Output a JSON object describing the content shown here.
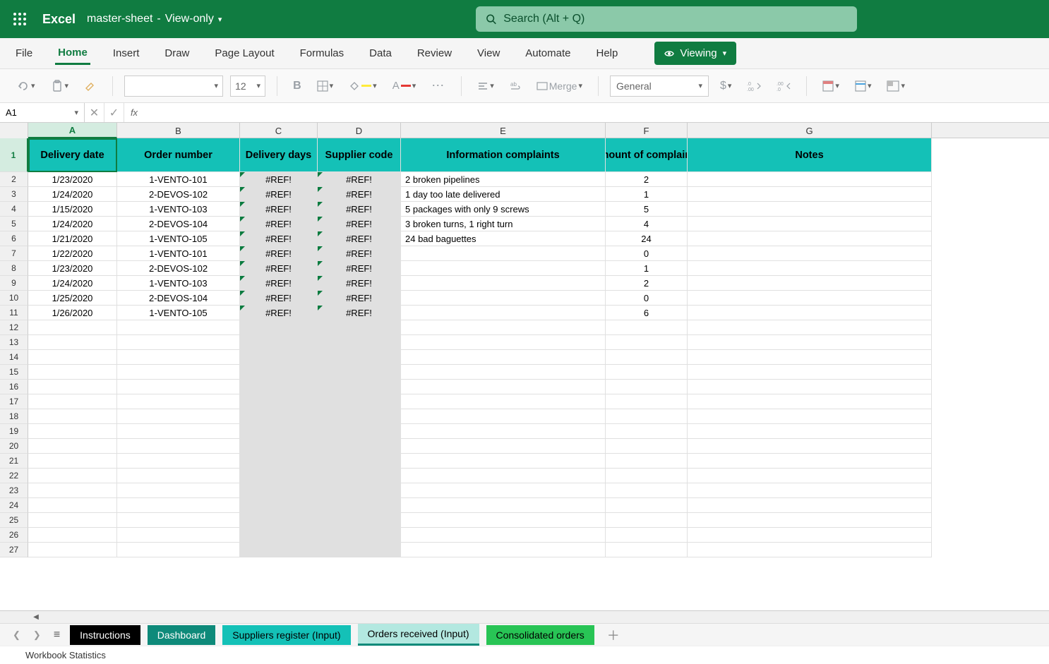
{
  "app": {
    "name": "Excel"
  },
  "doc": {
    "name": "master-sheet",
    "mode": "View-only"
  },
  "search": {
    "placeholder": "Search (Alt + Q)"
  },
  "ribbon": {
    "tabs": [
      "File",
      "Home",
      "Insert",
      "Draw",
      "Page Layout",
      "Formulas",
      "Data",
      "Review",
      "View",
      "Automate",
      "Help"
    ],
    "active": "Home",
    "viewing_label": "Viewing"
  },
  "toolbar": {
    "font_size": "12",
    "merge_label": "Merge",
    "number_format": "General"
  },
  "namebox": {
    "value": "A1"
  },
  "formula": {
    "value": ""
  },
  "columns": [
    "A",
    "B",
    "C",
    "D",
    "E",
    "F",
    "G"
  ],
  "headers": {
    "A": "Delivery date",
    "B": "Order number",
    "C": "Delivery days",
    "D": "Supplier code",
    "E": "Information complaints",
    "F": "Amount of complaints",
    "G": "Notes"
  },
  "rows": [
    {
      "n": 2,
      "A": "1/23/2020",
      "B": "1-VENTO-101",
      "C": "#REF!",
      "D": "#REF!",
      "E": "2 broken pipelines",
      "F": "2",
      "G": ""
    },
    {
      "n": 3,
      "A": "1/24/2020",
      "B": "2-DEVOS-102",
      "C": "#REF!",
      "D": "#REF!",
      "E": "1 day too late delivered",
      "F": "1",
      "G": ""
    },
    {
      "n": 4,
      "A": "1/15/2020",
      "B": "1-VENTO-103",
      "C": "#REF!",
      "D": "#REF!",
      "E": "5 packages with only 9 screws",
      "F": "5",
      "G": ""
    },
    {
      "n": 5,
      "A": "1/24/2020",
      "B": "2-DEVOS-104",
      "C": "#REF!",
      "D": "#REF!",
      "E": "3 broken turns, 1 right turn",
      "F": "4",
      "G": ""
    },
    {
      "n": 6,
      "A": "1/21/2020",
      "B": "1-VENTO-105",
      "C": "#REF!",
      "D": "#REF!",
      "E": "24 bad baguettes",
      "F": "24",
      "G": ""
    },
    {
      "n": 7,
      "A": "1/22/2020",
      "B": "1-VENTO-101",
      "C": "#REF!",
      "D": "#REF!",
      "E": "",
      "F": "0",
      "G": ""
    },
    {
      "n": 8,
      "A": "1/23/2020",
      "B": "2-DEVOS-102",
      "C": "#REF!",
      "D": "#REF!",
      "E": "",
      "F": "1",
      "G": ""
    },
    {
      "n": 9,
      "A": "1/24/2020",
      "B": "1-VENTO-103",
      "C": "#REF!",
      "D": "#REF!",
      "E": "",
      "F": "2",
      "G": ""
    },
    {
      "n": 10,
      "A": "1/25/2020",
      "B": "2-DEVOS-104",
      "C": "#REF!",
      "D": "#REF!",
      "E": "",
      "F": "0",
      "G": ""
    },
    {
      "n": 11,
      "A": "1/26/2020",
      "B": "1-VENTO-105",
      "C": "#REF!",
      "D": "#REF!",
      "E": "",
      "F": "6",
      "G": ""
    }
  ],
  "empty_rows": [
    12,
    13,
    14,
    15,
    16,
    17,
    18,
    19,
    20,
    21,
    22,
    23,
    24,
    25,
    26,
    27
  ],
  "sheets": {
    "tabs": [
      "Instructions",
      "Dashboard",
      "Suppliers register (Input)",
      "Orders received (Input)",
      "Consolidated orders"
    ],
    "active": "Orders received (Input)"
  },
  "status": {
    "text": "Workbook Statistics"
  }
}
